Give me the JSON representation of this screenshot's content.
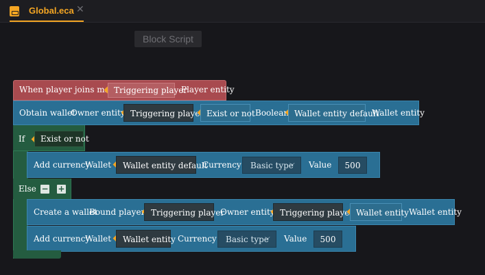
{
  "tab": {
    "title": "Global.eca",
    "close": "✕"
  },
  "block_script_label": "Block Script",
  "event": {
    "label": "When player joins match",
    "arg": "Triggering player",
    "type": "Player entity"
  },
  "obtain": {
    "label": "Obtain wallet",
    "owner_label": "Owner entity",
    "owner_value": "Triggering player",
    "exist": "Exist or not",
    "bool": "Boolean",
    "wallet_default": "Wallet entity default",
    "type": "Wallet entity"
  },
  "if_block": {
    "label": "If",
    "cond": "Exist or not"
  },
  "add1": {
    "label": "Add currency",
    "wallet_label": "Wallet",
    "wallet_value": "Wallet entity default",
    "currency_label": "Currency",
    "currency_value": "Basic type",
    "value_label": "Value",
    "value": "500"
  },
  "else_label": "Else",
  "else_controls": {
    "minus": "−",
    "plus": "+"
  },
  "create": {
    "label": "Create a wallet",
    "bound_label": "Bound player",
    "bound_value": "Triggering player",
    "owner_label": "Owner entity",
    "owner_value": "Triggering player",
    "wallet_slot": "Wallet entity",
    "type": "Wallet entity"
  },
  "add2": {
    "label": "Add currency",
    "wallet_label": "Wallet",
    "wallet_value": "Wallet entity",
    "currency_label": "Currency",
    "currency_value": "Basic type",
    "value_label": "Value",
    "value": "500"
  },
  "icons": {
    "dropdown": "chevron-down-icon",
    "file": "file-icon",
    "diamond": "diamond-icon"
  },
  "colors": {
    "accent": "#f5a623",
    "event": "#a84a4f",
    "action": "#2a6f94",
    "control": "#245c40"
  }
}
